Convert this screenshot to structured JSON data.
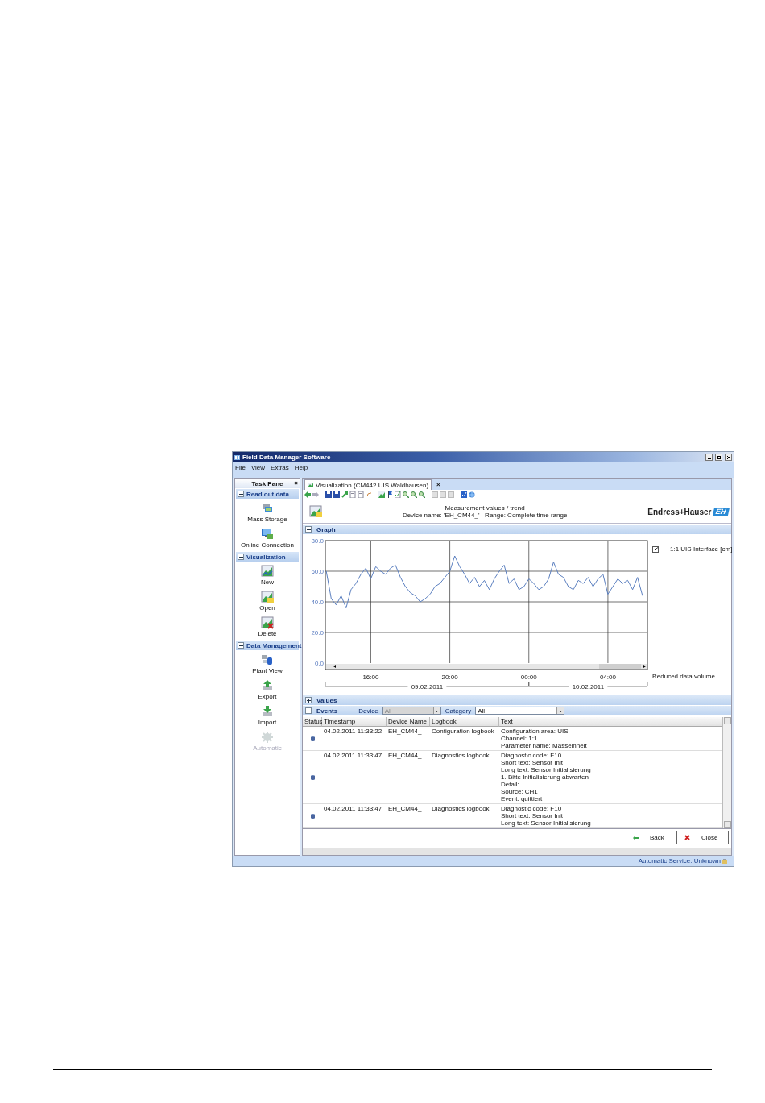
{
  "window": {
    "title": "Field Data Manager Software"
  },
  "menu": [
    "File",
    "View",
    "Extras",
    "Help"
  ],
  "task_pane": {
    "title": "Task Pane",
    "close": "×",
    "sections": [
      {
        "title": "Read out data",
        "expanded": true,
        "items": [
          {
            "label": "Mass Storage",
            "kind": "storage",
            "disabled": false
          },
          {
            "label": "Online Connection",
            "kind": "monitor",
            "disabled": false
          }
        ]
      },
      {
        "title": "Visualization",
        "expanded": true,
        "items": [
          {
            "label": "New",
            "kind": "chart",
            "disabled": false
          },
          {
            "label": "Open",
            "kind": "chart-open",
            "disabled": false
          },
          {
            "label": "Delete",
            "kind": "chart-delete",
            "disabled": false
          }
        ]
      },
      {
        "title": "Data Management",
        "expanded": true,
        "items": [
          {
            "label": "Plant View",
            "kind": "plant",
            "disabled": false
          },
          {
            "label": "Export",
            "kind": "export",
            "disabled": false
          },
          {
            "label": "Import",
            "kind": "import",
            "disabled": false
          },
          {
            "label": "Automatic",
            "kind": "gear",
            "disabled": true
          }
        ]
      }
    ]
  },
  "document_tab": {
    "label": "Visualization (CM442 UIS Waldhausen)",
    "close": "×",
    "selected": true
  },
  "header": {
    "title": "Measurement values / trend",
    "subtitle": "Device name: 'EH_CM44_'   Range: Complete time range",
    "logo": "Endress+Hauser",
    "logo_mark": "EH"
  },
  "graph": {
    "title": "Graph",
    "expanded": true,
    "legend_checked": true,
    "note": "Reduced data volume",
    "dates": [
      "09.02.2011",
      "10.02.2011"
    ],
    "chart_data": {
      "type": "line",
      "categories": [
        null,
        null,
        null,
        null,
        null,
        null,
        null,
        null,
        null,
        "16:00",
        null,
        null,
        null,
        null,
        null,
        null,
        null,
        null,
        null,
        null,
        null,
        null,
        null,
        null,
        null,
        "20:00",
        null,
        null,
        null,
        null,
        null,
        null,
        null,
        null,
        null,
        null,
        null,
        null,
        null,
        null,
        null,
        "00:00",
        null,
        null,
        null,
        null,
        null,
        null,
        null,
        null,
        null,
        null,
        null,
        null,
        null,
        null,
        null,
        "04:00",
        null,
        null,
        null,
        null,
        null,
        null,
        null
      ],
      "series": [
        {
          "name": "1:1 UIS Interface [cm]",
          "color": "#5b7fc0",
          "values": [
            60,
            42,
            38,
            44,
            36,
            48,
            52,
            58,
            62,
            55,
            63,
            60,
            58,
            62,
            64,
            56,
            50,
            46,
            44,
            40,
            42,
            45,
            50,
            52,
            56,
            60,
            70,
            63,
            58,
            52,
            56,
            50,
            54,
            48,
            55,
            60,
            64,
            52,
            55,
            48,
            50,
            55,
            52,
            48,
            50,
            55,
            66,
            58,
            56,
            50,
            48,
            54,
            52,
            56,
            50,
            55,
            58,
            45,
            50,
            55,
            52,
            54,
            48,
            56,
            44
          ]
        }
      ],
      "ylim": [
        0,
        80
      ],
      "grid": true,
      "yticks": [
        {
          "value": 0,
          "label": "0.0"
        },
        {
          "value": 20,
          "label": "20.0"
        },
        {
          "value": 40,
          "label": "40.0"
        },
        {
          "value": 60,
          "label": "60.0"
        },
        {
          "value": 80,
          "label": "80.0"
        }
      ]
    }
  },
  "values_section": {
    "title": "Values",
    "expanded": false
  },
  "events": {
    "title": "Events",
    "expanded": true,
    "filters": [
      {
        "label": "Device",
        "value": "All",
        "disabled": true
      },
      {
        "label": "Category",
        "value": "All",
        "disabled": false
      }
    ],
    "columns": [
      "Status",
      "Timestamp",
      "Device Name",
      "Logbook",
      "Text"
    ],
    "rows": [
      {
        "timestamp": "04.02.2011 11:33:22",
        "device": "EH_CM44_",
        "logbook": "Configuration logbook",
        "text": "Configuration area: UIS\nChannel: 1:1\nParameter name: Masseinheit"
      },
      {
        "timestamp": "04.02.2011 11:33:47",
        "device": "EH_CM44_",
        "logbook": "Diagnostics logbook",
        "text": "Diagnostic code: F10\nShort text: Sensor Init\nLong text: Sensor Initialisierung\n1. Bitte Initialisierung abwarten\nDetail:\nSource: CH1\nEvent: quittiert"
      },
      {
        "timestamp": "04.02.2011 11:33:47",
        "device": "EH_CM44_",
        "logbook": "Diagnostics logbook",
        "text": "Diagnostic code: F10\nShort text: Sensor Init\nLong text: Sensor Initialisierung"
      }
    ]
  },
  "buttons": [
    {
      "label": "Back",
      "kind": "back"
    },
    {
      "label": "Close",
      "kind": "close"
    }
  ],
  "status_bar": {
    "text": "Automatic Service: Unknown"
  }
}
